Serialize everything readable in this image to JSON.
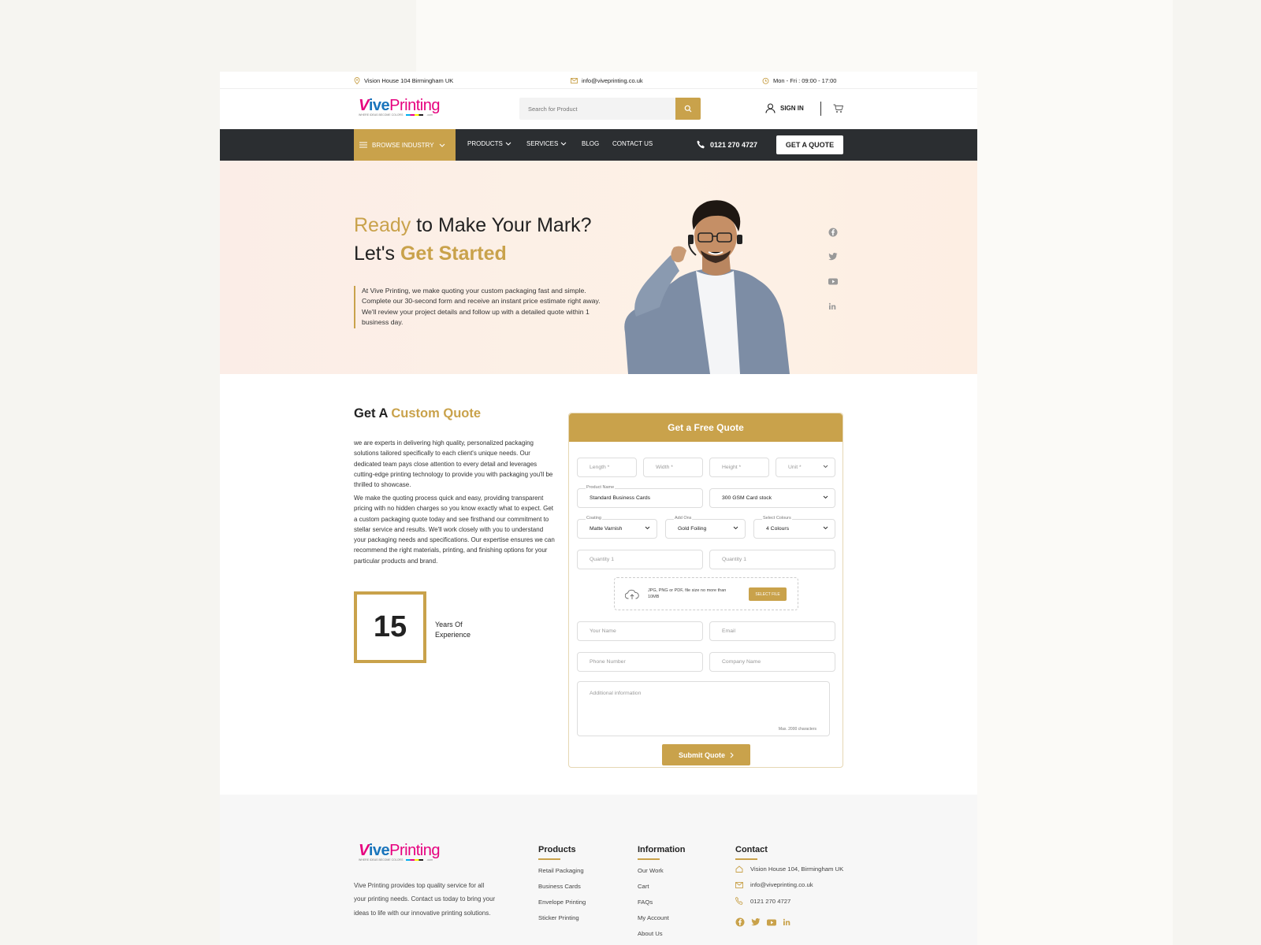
{
  "topbar": {
    "address": "Vision House 104  Birmingham UK",
    "email": "info@viveprinting.co.uk",
    "hours": "Mon - Fri : 09:00 - 17:00"
  },
  "brand": {
    "name_part1": "V",
    "name_part2": "ive",
    "name_part3": "Printing",
    "tagline": "WHERE IDEAS BECOME COLORS",
    "domain": ".com"
  },
  "header": {
    "search_placeholder": "Search for Product",
    "signin_label": "SIGN IN"
  },
  "nav": {
    "browse_label": "BROWSE INDUSTRY",
    "items": [
      "PRODUCTS",
      "SERVICES",
      "BLOG",
      "CONTACT US"
    ],
    "phone": "0121 270 4727",
    "quote_button": "GET A QUOTE"
  },
  "hero": {
    "title_a": "Ready",
    "title_b": " to Make Your Mark? Let's ",
    "title_c": "Get Started",
    "description": "At Vive Printing, we make quoting your custom packaging fast and simple. Complete our 30-second form and receive an instant price estimate right away. We'll review your project details and follow up with a detailed quote within 1 business day."
  },
  "quote_section": {
    "title_a": "Get A ",
    "title_b": "Custom Quote",
    "para1": "we are experts in delivering high quality, personalized packaging solutions tailored specifically to each client's unique needs. Our dedicated team pays close attention to every detail and leverages cutting-edge printing technology to provide you with packaging you'll be thrilled to showcase.",
    "para2": "We make the quoting process quick and easy, providing transparent pricing with no hidden charges so you know exactly what to expect. Get a custom packaging quote today and see firsthand our commitment to stellar service and results. We'll work closely with you to understand your packaging needs and specifications. Our expertise ensures we can recommend the right materials, printing, and finishing options for your particular products and brand.",
    "years_value": "15",
    "years_label": "Years Of Experience"
  },
  "form": {
    "title": "Get a Free Quote",
    "length": "Length *",
    "width": "Width *",
    "height": "Height *",
    "unit": "Unit *",
    "product_name_label": "Product Name",
    "product_name": "Standard Business Cards",
    "stock": "300 GSM Card stock",
    "coating_label": "Coating",
    "coating": "Matte Varnish",
    "addons_label": "Add Ons",
    "addons": "Gold Foiling",
    "colours_label": "Select Colours",
    "colours": "4 Colours",
    "quantity1": "Quantity 1",
    "quantity2": "Quantity 1",
    "upload_text": "JPG, PNG or PDF, file size no more than 10MB",
    "select_file": "SELECT FILE",
    "your_name": "Your Name",
    "email": "Email",
    "phone": "Phone Number",
    "company": "Company Name",
    "additional": "Additional information",
    "max_chars": "Max. 2000 characters",
    "submit": "Submit Quote"
  },
  "footer": {
    "description": "Vive Printing provides top quality service for all your printing needs. Contact us today to bring your ideas to life with our innovative printing solutions.",
    "products_title": "Products",
    "products": [
      "Retail Packaging",
      "Business Cards",
      "Envelope Printing",
      "Sticker Printing"
    ],
    "info_title": "Information",
    "info": [
      "Our Work",
      "Cart",
      "FAQs",
      "My Account",
      "About Us"
    ],
    "contact_title": "Contact",
    "contact_address": "Vision House 104, Birmingham UK",
    "contact_email": "info@viveprinting.co.uk",
    "contact_phone": "0121 270 4727"
  },
  "colors": {
    "accent": "#c9a24b",
    "nav_bg": "#2b2e31",
    "hero_bg": "#fdf0e7"
  }
}
